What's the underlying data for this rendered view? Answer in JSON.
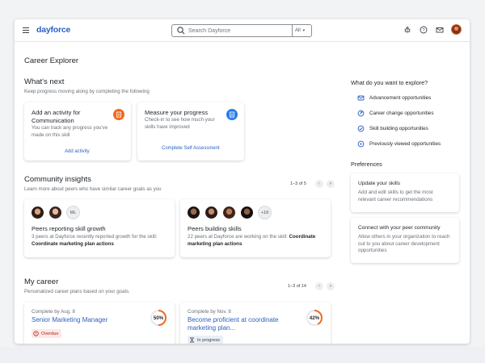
{
  "brand": {
    "logo": "dayforce",
    "accent": "#2c5fc4"
  },
  "header": {
    "search_placeholder": "Search Dayforce",
    "search_scope": "All",
    "icons": [
      "menu-icon",
      "bug-icon",
      "help-icon",
      "mail-icon",
      "avatar"
    ]
  },
  "page": {
    "title": "Career Explorer"
  },
  "whats_next": {
    "title": "What's next",
    "subtitle": "Keep progress moving along by completing the following",
    "cards": [
      {
        "title": "Add an activity for Communication",
        "desc": "You can track any progress you've made on this skill",
        "link": "Add activity",
        "icon": "clipboard-icon",
        "icon_color": "#f26a21"
      },
      {
        "title": "Measure your progress",
        "desc": "Check-in to see how much your skills have improved",
        "link": "Complete Self Assessment",
        "icon": "document-icon",
        "icon_color": "#2b7de9"
      }
    ]
  },
  "community": {
    "title": "Community insights",
    "subtitle": "Learn more about peers who have similar career goals as you",
    "pager": "1–3 of 5",
    "cards": [
      {
        "title": "Peers reporting skill growth",
        "desc_pre": "3 peers at Dayforce recently reported growth for the skill:",
        "desc_bold": "Coordinate marketing plan actions",
        "extra": "ML"
      },
      {
        "title": "Peers building skills",
        "desc_pre": "22 peers at Dayforce are working on the skill:",
        "desc_bold": "Coordinate marketing plan actions",
        "extra": "+18"
      }
    ]
  },
  "my_career": {
    "title": "My career",
    "subtitle": "Personalized career plans based on your goals.",
    "pager": "1–3 of 14",
    "cards": [
      {
        "due": "Complete by Aug. 8",
        "title": "Senior Marketing Manager",
        "percent": 50,
        "percent_label": "50%",
        "status": "Overdue"
      },
      {
        "due": "Complete by Nov. 8",
        "title": "Become proficient at coordinate marketing plan...",
        "percent": 42,
        "percent_label": "42%",
        "status": "In progress"
      }
    ]
  },
  "explore": {
    "title": "What do you want to explore?",
    "items": [
      {
        "label": "Advancement opportunities",
        "icon": "advancement-icon"
      },
      {
        "label": "Career change opportunities",
        "icon": "career-change-icon"
      },
      {
        "label": "Skill building opportunities",
        "icon": "skill-building-icon"
      },
      {
        "label": "Previously viewed opportunities",
        "icon": "play-circle-icon"
      }
    ]
  },
  "preferences": {
    "title": "Preferences",
    "cards": [
      {
        "title": "Update your skills",
        "desc": "Add and edit skills to get the most relevant career recommendations"
      },
      {
        "title": "Connect with your peer community",
        "desc": "Allow others in your organization to reach out to you about career development opportunities"
      }
    ]
  },
  "colors": {
    "ring_track": "#e6e8eb",
    "ring_fill": "#f26a21",
    "overdue": "#b42318"
  }
}
